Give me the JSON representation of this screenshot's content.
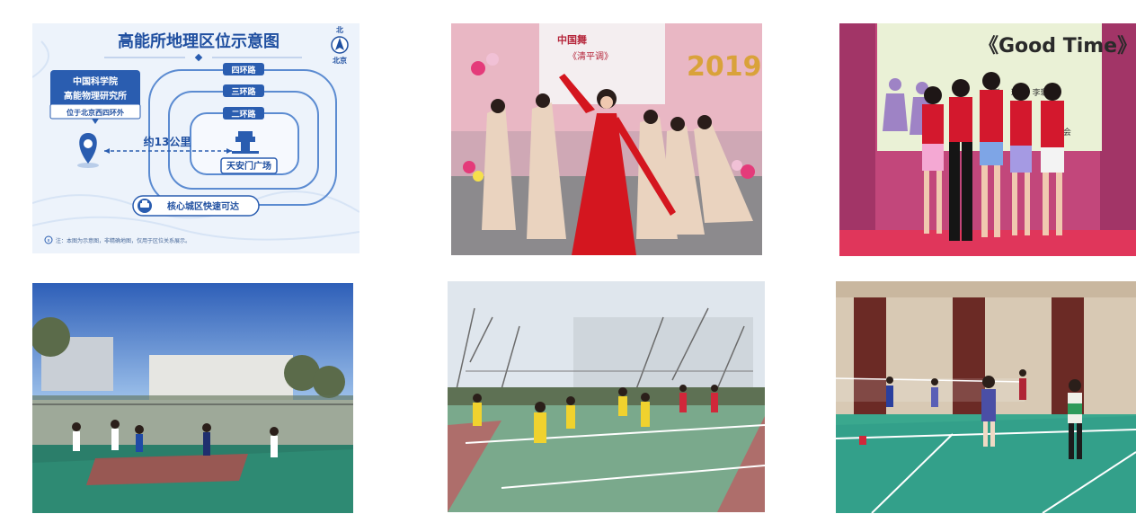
{
  "map": {
    "title": "高能所地理区位示意图",
    "compass": {
      "north_char": "北",
      "label": "北京"
    },
    "institute": {
      "line1": "中国科学院",
      "line2": "高能物理研究所",
      "sub": "位于北京西四环外"
    },
    "rings": {
      "r4": "四环路",
      "r3": "三环路",
      "r2": "二环路"
    },
    "distance": "约13公里",
    "landmark": "天安门广场",
    "badge": "核心城区快速可达",
    "note": "注：本图为示意图，非精确地图，仅用于区位关系展示。",
    "colors": {
      "primary": "#2a5db0",
      "light": "#e9f1fb"
    },
    "icons": [
      "map-pin-icon",
      "tiananmen-icon",
      "car-icon",
      "info-icon",
      "compass-icon"
    ]
  },
  "photos": {
    "dance": {
      "banner_line1": "中国舞",
      "banner_line2": "《清平调》",
      "year": "2019"
    },
    "goodtime": {
      "banner_title": "《Good Time》",
      "names": "者：  珊   荣  李璐",
      "club": "工    协会"
    },
    "basketball": {},
    "volleyball": {},
    "badminton": {}
  }
}
